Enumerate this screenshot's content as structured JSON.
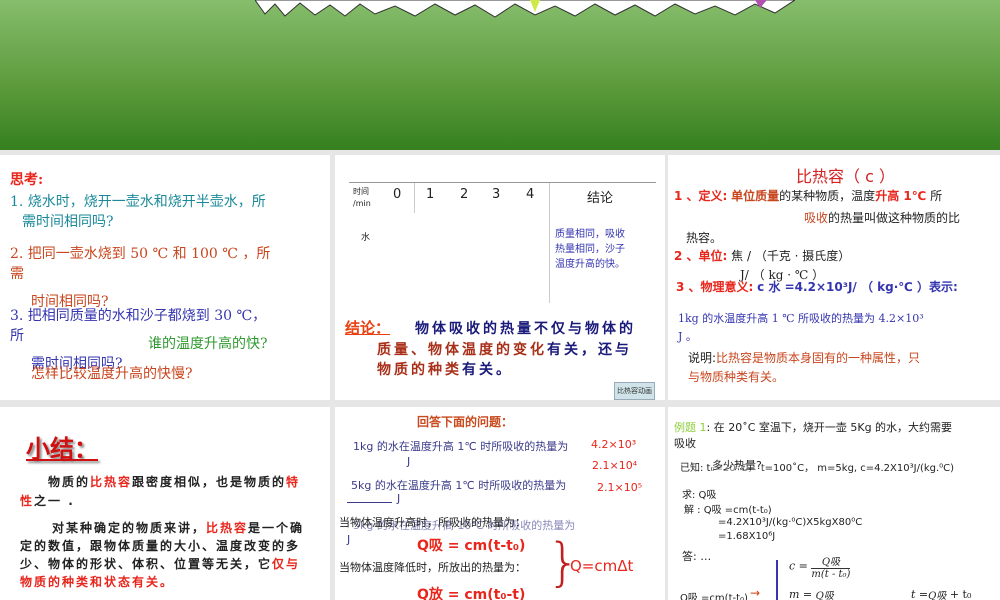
{
  "slide1": {
    "title": "思考:",
    "q1a": "1. 烧水时，烧开一壶水和烧开半壶水，所",
    "q1b": "需时间相同吗?",
    "q2a": "2. 把同一壶水烧到 50 ℃ 和 100 ℃ ，所",
    "q2b": "需",
    "q2c": "时间相同吗?",
    "q3a": "3. 把相同质量的水和沙子都烧到 30 ℃，",
    "q3b": "所",
    "q3c": "需时间相同吗?",
    "q4": "谁的温度升高的快?",
    "q5": "怎样比较温度升高的快慢?"
  },
  "slide2": {
    "headers": [
      "时间\n/min",
      "0",
      "1",
      "2",
      "3",
      "4",
      "结论"
    ],
    "time_label": "时间",
    "unit_label": "/min",
    "cols": [
      "0",
      "1",
      "2",
      "3",
      "4"
    ],
    "conclusion_header": "结论",
    "row_label": "水",
    "conclusion_text": [
      "质量相同，吸收",
      "热量相同，沙子",
      "温度升高的快。"
    ],
    "conclusion_prefix": "结论：",
    "conclusion_l1": "物体吸收的热量不仅与物体的",
    "conclusion_l2a": "质量、物体",
    "conclusion_l2b": "温度的变化",
    "conclusion_l2c": "有关，还与",
    "conclusion_l3a": "物质的种类",
    "conclusion_l3b": "有关。",
    "button": "比热容动画"
  },
  "slide3": {
    "title": "比热容（ c ）",
    "d_label": "1 、定义:",
    "d_a": "单位质量",
    "d_b": "的某种物质，温度",
    "d_c": "升高 1℃",
    "d_d": "所",
    "d_e": "吸收",
    "d_f": "的热量叫做这种物质的比",
    "d_g": "热容。",
    "u_label": "2 、单位:",
    "u_text": "焦 / （千克 · 摄氏度）",
    "u_text2": "J/ （ kg · ℃  ）",
    "m_label": "3 、物理意义:",
    "m_formula": "c 水 =4.2×10³J/ （ kg·℃ ）表示:",
    "m_text1": "1kg 的水温度升高 1 ℃ 所吸收的热量为 4.2×10³",
    "m_text2": "J 。",
    "note_label": "说明:",
    "note_text1": "比热容是物质本身固有的一种属性，只",
    "note_text2": "与物质种类有关。"
  },
  "slide4": {
    "title": "小结：",
    "p1a": "物质的",
    "p1b": "比热容",
    "p1c": "跟密度相似，也是物质的",
    "p1d": "特",
    "p1e": "性",
    "p1f": "之一 .",
    "p2a": "对某种确定的物质来讲，",
    "p2b": "比热容",
    "p2c": "是一个确",
    "p2d": "定的数值，跟物体质量的大小、温度改变的多",
    "p2e": "少、物体的形状、体积、位置等无关，它",
    "p2f": "仅与",
    "p2g": "物质的种类和状态有关。"
  },
  "slide5": {
    "title": "回答下面的问题：",
    "l1": "1kg 的水在温度升高 1℃ 时所吸收的热量为",
    "a1": "4.2×10³",
    "j": "J",
    "a2": "2.1×10⁴",
    "l2": "5kg 的水在温度升高 1℃ 时所吸收的热量为",
    "a3": "2.1×10⁵",
    "l3": "当物体温度升高时，所吸收的热量为：",
    "l3b": "5kg 的水在温度升高 10℃ 时所吸收的热量为",
    "f1": "Q吸 = cm(t-t₀)",
    "l4": "当物体温度降低时，所放出的热量为：",
    "f2": "Q放 = cm(t₀-t)",
    "f3": "Q=cmΔt"
  },
  "slide6": {
    "ex_label": "例题 1",
    "ex_text": ": 在 20˚C 室温下，烧开一壶 5Kg 的水，大约需要",
    "ex_text2": "吸收",
    "known": "已知: t₀=20˚C， t=100˚C， m=5kg, c=4.2X10³J/(kg.⁰C)",
    "overlay": "多少热量?",
    "find": "求: Q吸",
    "sol": "解 : Q吸 =cm(t-t₀)",
    "step1": "=4.2X10³J/(kg·⁰C)X5kgX80⁰C",
    "step2": "=1.68X10⁶J",
    "ans": "答: …",
    "q_formula": "Q吸 =cm(t-t₀)",
    "c_eq": "c =",
    "m_eq": "m =",
    "t_eq": "t =",
    "num": "Q吸",
    "den_c": "m(t - t₀)",
    "tail": "+ t₀"
  },
  "colors": {
    "banner": "#5e9c3e",
    "red": "#e8261c",
    "blue": "#3535b0"
  }
}
